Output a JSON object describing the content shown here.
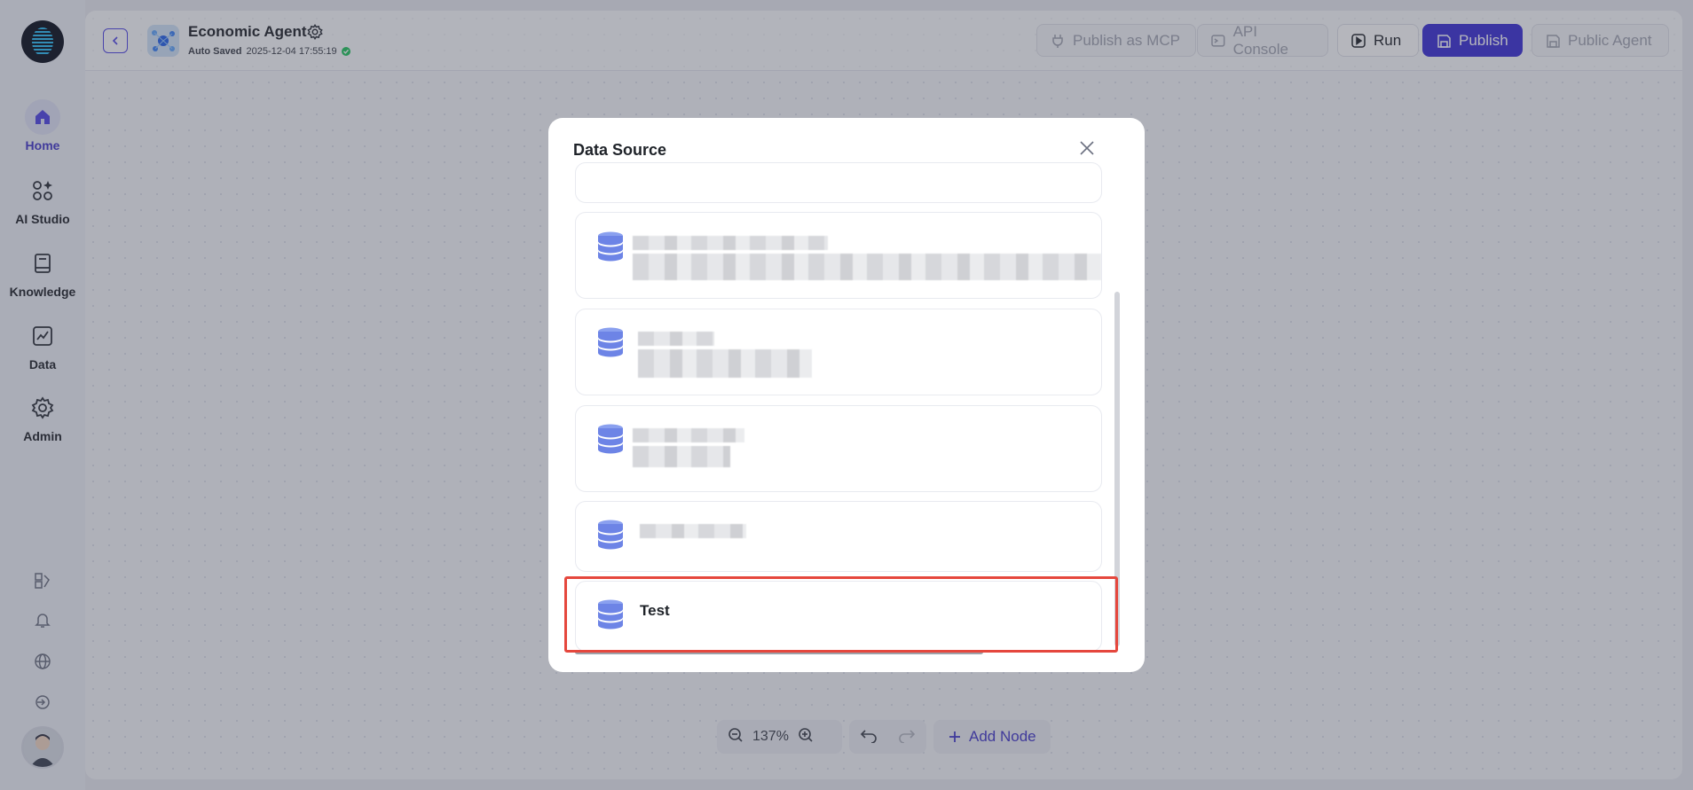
{
  "nav": {
    "items": [
      {
        "label": "Home",
        "icon": "home-icon",
        "active": true
      },
      {
        "label": "AI Studio",
        "icon": "ai-studio-icon",
        "active": false
      },
      {
        "label": "Knowledge",
        "icon": "book-icon",
        "active": false
      },
      {
        "label": "Data",
        "icon": "chart-icon",
        "active": false
      },
      {
        "label": "Admin",
        "icon": "gear-icon",
        "active": false
      }
    ]
  },
  "header": {
    "title": "Economic Agent",
    "saved_label": "Auto Saved",
    "saved_time": "2025-12-04 17:55:19"
  },
  "toolbar": {
    "publish_mcp": "Publish as MCP",
    "api_console": "API Console",
    "run": "Run",
    "publish": "Publish",
    "public_agent": "Public Agent"
  },
  "canvas": {
    "zoom": "137%",
    "add_node": "Add Node"
  },
  "modal": {
    "title": "Data Source",
    "selected_item": "Test"
  },
  "colors": {
    "accent": "#3b30d6",
    "highlight": "#e5473d",
    "status_ok": "#22c55e"
  }
}
